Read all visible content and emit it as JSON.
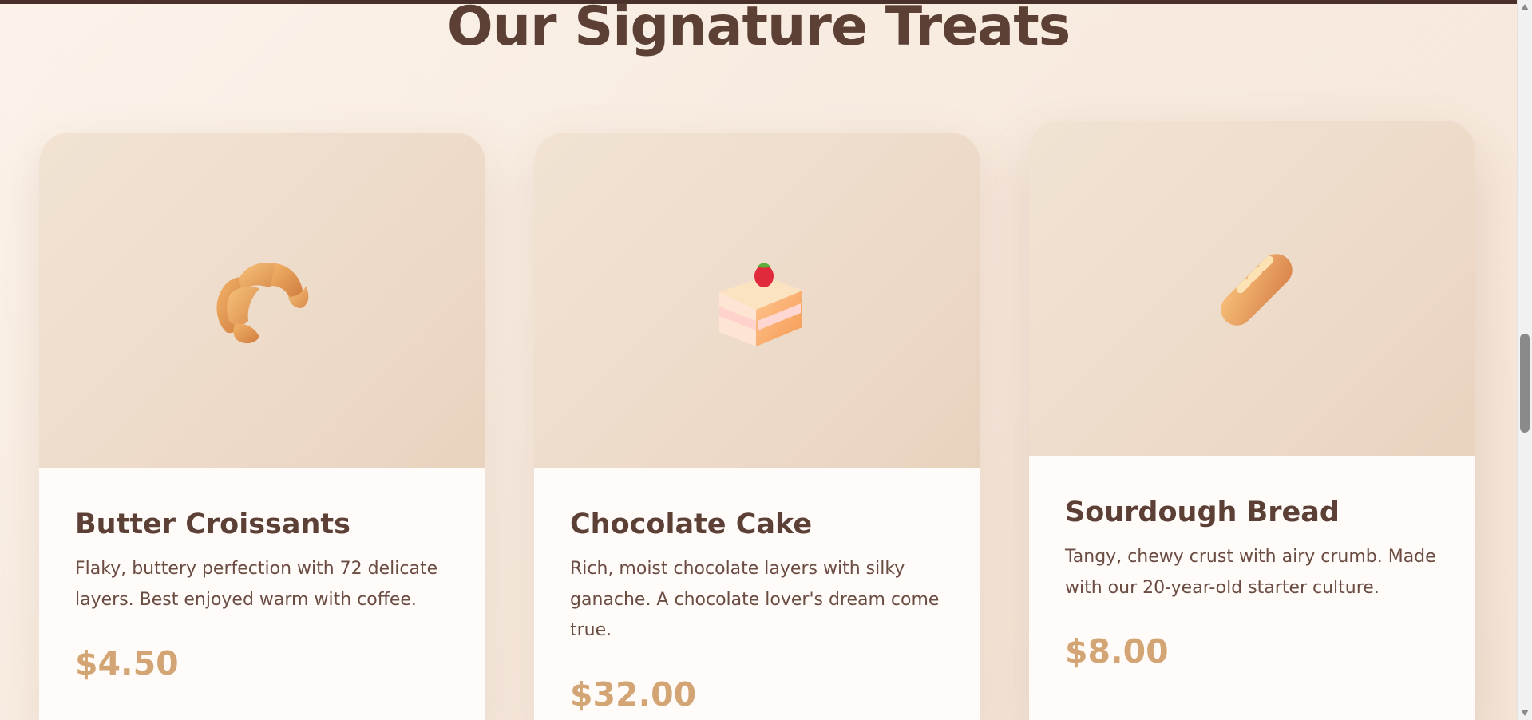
{
  "section": {
    "title": "Our Signature Treats"
  },
  "products": [
    {
      "name": "Butter Croissants",
      "description": "Flaky, buttery perfection with 72 delicate layers. Best enjoyed warm with coffee.",
      "price": "$4.50",
      "icon": "croissant-icon"
    },
    {
      "name": "Chocolate Cake",
      "description": "Rich, moist chocolate layers with silky ganache. A chocolate lover's dream come true.",
      "price": "$32.00",
      "icon": "cake-slice-icon"
    },
    {
      "name": "Sourdough Bread",
      "description": "Tangy, chewy crust with airy crumb. Made with our 20-year-old starter culture.",
      "price": "$8.00",
      "icon": "bread-icon"
    }
  ],
  "colors": {
    "heading": "#5c3f35",
    "price": "#d4a574",
    "card_image_bg": "#eedccb",
    "top_bar": "#4a302b"
  }
}
